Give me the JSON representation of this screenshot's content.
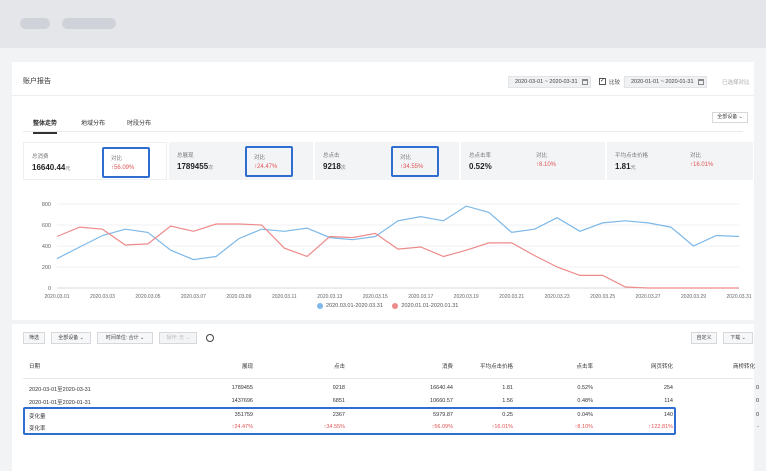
{
  "page": {
    "title": "账户报告"
  },
  "date_range": {
    "primary": "2020-03-01 ~ 2020-03-31",
    "compare_checked": true,
    "compare_label": "比较",
    "secondary": "2020-01-01 ~ 2020-01-31",
    "clear_label": "已选择对比"
  },
  "tabs": [
    {
      "label": "整体走势",
      "active": true
    },
    {
      "label": "地域分布",
      "active": false
    },
    {
      "label": "时段分布",
      "active": false
    }
  ],
  "device_select": "全部设备",
  "metrics": [
    {
      "label": "总消费",
      "value": "16640.44",
      "unit": "元",
      "cmp_label": "对比",
      "cmp_value": "56.09%",
      "highlight": true
    },
    {
      "label": "总展现",
      "value": "1789455",
      "unit": "次",
      "cmp_label": "对比",
      "cmp_value": "24.47%",
      "highlight": true
    },
    {
      "label": "总点击",
      "value": "9218",
      "unit": "次",
      "cmp_label": "对比",
      "cmp_value": "34.55%",
      "highlight": true
    },
    {
      "label": "总点击率",
      "value": "0.52%",
      "unit": "",
      "cmp_label": "对比",
      "cmp_value": "8.10%",
      "highlight": false
    },
    {
      "label": "平均点击价格",
      "value": "1.81",
      "unit": "元",
      "cmp_label": "对比",
      "cmp_value": "16.01%",
      "highlight": false
    }
  ],
  "chart_data": {
    "type": "line",
    "x": [
      "2020.03.01",
      "2020.03.02",
      "2020.03.03",
      "2020.03.04",
      "2020.03.05",
      "2020.03.06",
      "2020.03.07",
      "2020.03.08",
      "2020.03.09",
      "2020.03.10",
      "2020.03.11",
      "2020.03.12",
      "2020.03.13",
      "2020.03.14",
      "2020.03.15",
      "2020.03.16",
      "2020.03.17",
      "2020.03.18",
      "2020.03.19",
      "2020.03.20",
      "2020.03.21",
      "2020.03.22",
      "2020.03.23",
      "2020.03.24",
      "2020.03.25",
      "2020.03.26",
      "2020.03.27",
      "2020.03.28",
      "2020.03.29",
      "2020.03.30",
      "2020.03.31"
    ],
    "xticks": [
      "2020.03.01",
      "2020.03.03",
      "2020.03.05",
      "2020.03.07",
      "2020.03.09",
      "2020.03.11",
      "2020.03.13",
      "2020.03.15",
      "2020.03.17",
      "2020.03.19",
      "2020.03.21",
      "2020.03.23",
      "2020.03.25",
      "2020.03.27",
      "2020.03.29",
      "2020.03.31"
    ],
    "yticks": [
      0,
      200,
      400,
      600,
      800
    ],
    "ylim": [
      0,
      800
    ],
    "grid": true,
    "legend": "bottom",
    "series": [
      {
        "name": "2020.03.01-2020.03.31",
        "color": "#7db8e8",
        "values": [
          280,
          390,
          500,
          560,
          530,
          360,
          270,
          300,
          470,
          560,
          540,
          570,
          480,
          460,
          490,
          640,
          680,
          640,
          780,
          720,
          530,
          560,
          670,
          540,
          620,
          640,
          620,
          580,
          400,
          500,
          490
        ]
      },
      {
        "name": "2020.01.01-2020.01.31",
        "color": "#ee8a8a",
        "values": [
          490,
          580,
          560,
          410,
          420,
          590,
          540,
          610,
          610,
          600,
          380,
          300,
          490,
          480,
          520,
          370,
          390,
          300,
          360,
          430,
          430,
          310,
          200,
          120,
          120,
          10,
          0,
          0,
          0,
          0,
          0
        ]
      }
    ]
  },
  "toolbar": {
    "filter": "筛选",
    "device": "全部设备",
    "time_unit": "时间单位: 合计",
    "action": "操作: 无",
    "custom": "自定义",
    "download": "下载"
  },
  "table": {
    "headers": [
      "日期",
      "展现",
      "点击",
      "消费",
      "平均点击价格",
      "点击率",
      "网页转化",
      "商桥转化"
    ],
    "rows": [
      [
        "2020-03-01至2020-03-31",
        "1789455",
        "9218",
        "16640.44",
        "1.81",
        "0.52%",
        "254",
        "0"
      ],
      [
        "2020-01-01至2020-01-31",
        "1437696",
        "6851",
        "10660.57",
        "1.56",
        "0.48%",
        "114",
        "0"
      ],
      [
        "变化量",
        "351759",
        "2367",
        "5979.87",
        "0.25",
        "0.04%",
        "140",
        "0"
      ],
      [
        "变化率",
        "↑24.47%",
        "↑34.55%",
        "↑56.09%",
        "↑16.01%",
        "↑8.10%",
        "↑122.81%",
        "-"
      ]
    ]
  }
}
